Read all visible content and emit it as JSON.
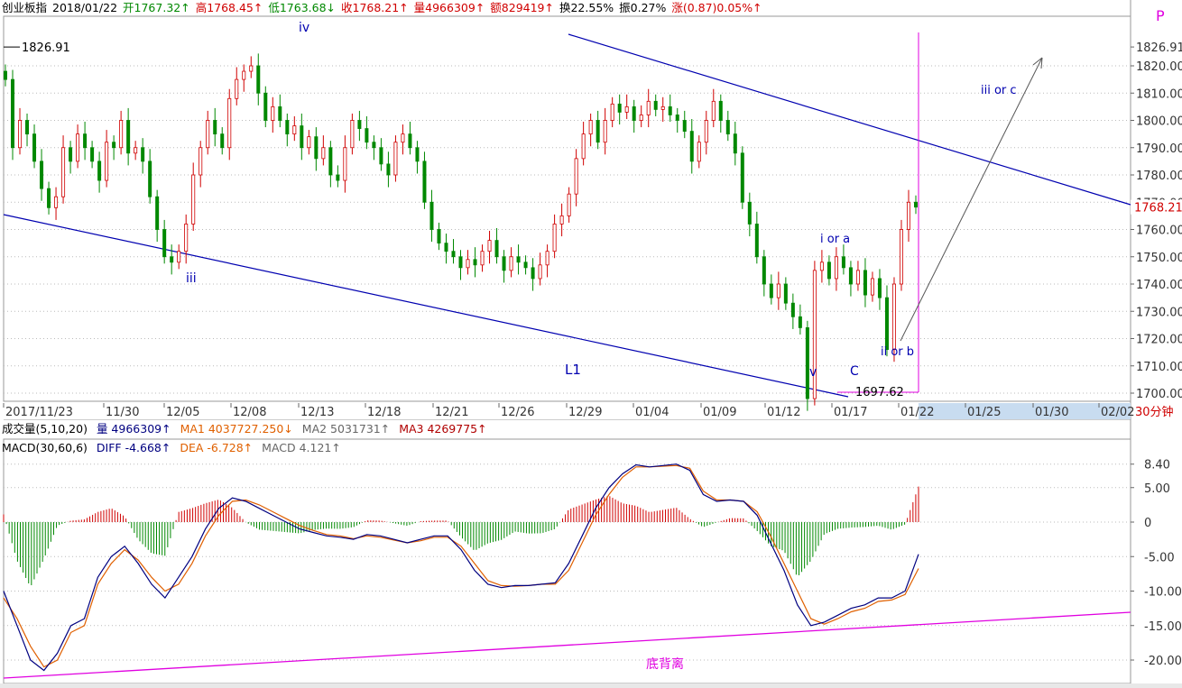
{
  "header": {
    "name": "创业板指",
    "date": "2018/01/22",
    "open": "开1767.32↑",
    "high": "高1768.45↑",
    "low": "低1763.68↓",
    "close": "收1768.21↑",
    "volume": "量4966309↑",
    "amount": "额829419↑",
    "turnover": "换22.55%",
    "amplitude": "振0.27%",
    "change": "涨(0.87)0.05%↑"
  },
  "corner_label": "P",
  "period_label": "30分钟",
  "volume_panel": {
    "title": "成交量(5,10,20)",
    "vol": "量 4966309↑",
    "ma1": "MA1 4037727.250↓",
    "ma2": "MA2 5031731↑",
    "ma3": "MA3 4269775↑"
  },
  "macd_panel": {
    "title": "MACD(30,60,6)",
    "diff": "DIFF -4.668↑",
    "dea": "DEA -6.728↑",
    "macd": "MACD 4.121↑"
  },
  "annotations": {
    "high_price": "1826.91",
    "low_price": "1697.62",
    "last_price": "1768.21",
    "wave_iv": "iv",
    "wave_iii": "iii",
    "wave_v": "v",
    "wave_C": "C",
    "wave_L1": "L1",
    "wave_i_or_a": "i or a",
    "wave_ii_or_b": "ii or b",
    "wave_iii_or_c": "iii or c",
    "divergence": "底背离"
  },
  "colors": {
    "up": "#d00000",
    "down": "#008800",
    "trend_line": "#0000b0",
    "magenta": "#e000e0",
    "dif": "#000080",
    "dea": "#e06000"
  },
  "chart_data": [
    {
      "type": "candlestick",
      "title": "创业板指 30分钟",
      "x_ticks": [
        "2017/11/23",
        "11/30",
        "12/05",
        "12/08",
        "12/13",
        "12/18",
        "12/21",
        "12/26",
        "12/29",
        "01/04",
        "01/09",
        "01/12",
        "01/17",
        "01/22",
        "01/25",
        "01/30",
        "02/02"
      ],
      "y_ticks": [
        "1826.91",
        "1820.00",
        "1810.00",
        "1800.00",
        "1790.00",
        "1780.00",
        "1770.00",
        "1760.00",
        "1750.00",
        "1740.00",
        "1730.00",
        "1720.00",
        "1710.00",
        "1700.00"
      ],
      "ylim": [
        1697,
        1830
      ],
      "close_path": [
        1815,
        1790,
        1800,
        1795,
        1785,
        1775,
        1768,
        1772,
        1790,
        1785,
        1795,
        1790,
        1785,
        1778,
        1792,
        1790,
        1800,
        1788,
        1790,
        1785,
        1772,
        1760,
        1750,
        1748,
        1752,
        1762,
        1780,
        1790,
        1800,
        1795,
        1790,
        1808,
        1815,
        1818,
        1820,
        1810,
        1800,
        1805,
        1800,
        1795,
        1798,
        1790,
        1794,
        1786,
        1790,
        1780,
        1778,
        1790,
        1800,
        1797,
        1792,
        1790,
        1784,
        1780,
        1792,
        1795,
        1790,
        1785,
        1770,
        1760,
        1755,
        1752,
        1750,
        1746,
        1749,
        1747,
        1752,
        1756,
        1750,
        1745,
        1750,
        1748,
        1746,
        1742,
        1747,
        1752,
        1762,
        1765,
        1773,
        1786,
        1795,
        1800,
        1792,
        1800,
        1806,
        1803,
        1805,
        1800,
        1802,
        1807,
        1804,
        1805,
        1802,
        1800,
        1796,
        1785,
        1792,
        1800,
        1807,
        1800,
        1795,
        1788,
        1770,
        1762,
        1750,
        1740,
        1735,
        1740,
        1733,
        1728,
        1724,
        1698,
        1745,
        1748,
        1742,
        1750,
        1746,
        1740,
        1745,
        1736,
        1742,
        1735,
        1716,
        1740,
        1760,
        1770,
        1768.21
      ],
      "high": 1826.91,
      "low": 1697.62,
      "last": 1768.21
    },
    {
      "type": "line",
      "title": "MACD(30,60,6)",
      "y_ticks": [
        "8.40",
        "5.00",
        "0",
        "-5.00",
        "-10.00",
        "-15.00",
        "-20.00"
      ],
      "ylim": [
        -22,
        10
      ],
      "series": [
        {
          "name": "DIFF",
          "values": [
            -10,
            -15,
            -20,
            -21.5,
            -19,
            -15,
            -14,
            -8,
            -5,
            -3.5,
            -6,
            -9,
            -11,
            -8,
            -5,
            -1,
            2,
            3.5,
            3,
            2,
            1,
            0,
            -1,
            -1.5,
            -2,
            -2.2,
            -2.5,
            -1.8,
            -2,
            -2.5,
            -3,
            -2.5,
            -2,
            -2,
            -4,
            -7,
            -9,
            -9.5,
            -9.2,
            -9.2,
            -9,
            -8.8,
            -6,
            -2,
            2,
            5,
            7,
            8.3,
            8,
            8.2,
            8.4,
            7.5,
            4,
            3,
            3.2,
            3,
            1,
            -3,
            -7,
            -12,
            -15,
            -14.5,
            -13.5,
            -12.5,
            -12,
            -11,
            -11,
            -10,
            -4.668
          ]
        },
        {
          "name": "DEA",
          "values": [
            -11,
            -14,
            -18,
            -21,
            -20,
            -16,
            -15,
            -9,
            -6,
            -4,
            -5.5,
            -8,
            -10,
            -9,
            -6,
            -2,
            1,
            3,
            3.2,
            2.5,
            1.5,
            0.5,
            -0.5,
            -1.2,
            -1.8,
            -2,
            -2.4,
            -2,
            -2.2,
            -2.6,
            -3,
            -2.7,
            -2.2,
            -2.2,
            -3.5,
            -6,
            -8.5,
            -9.2,
            -9.3,
            -9.2,
            -9,
            -9,
            -7,
            -3,
            1,
            4,
            6.5,
            8,
            8,
            8.1,
            8.2,
            7.8,
            4.5,
            3.2,
            3.2,
            3,
            1.5,
            -2,
            -6,
            -10,
            -14,
            -14.8,
            -14,
            -13,
            -12.5,
            -11.5,
            -11.3,
            -10.5,
            -6.728
          ]
        },
        {
          "name": "MACD",
          "values": [
            4.121
          ]
        }
      ],
      "trend_line_label": "底背离"
    }
  ]
}
